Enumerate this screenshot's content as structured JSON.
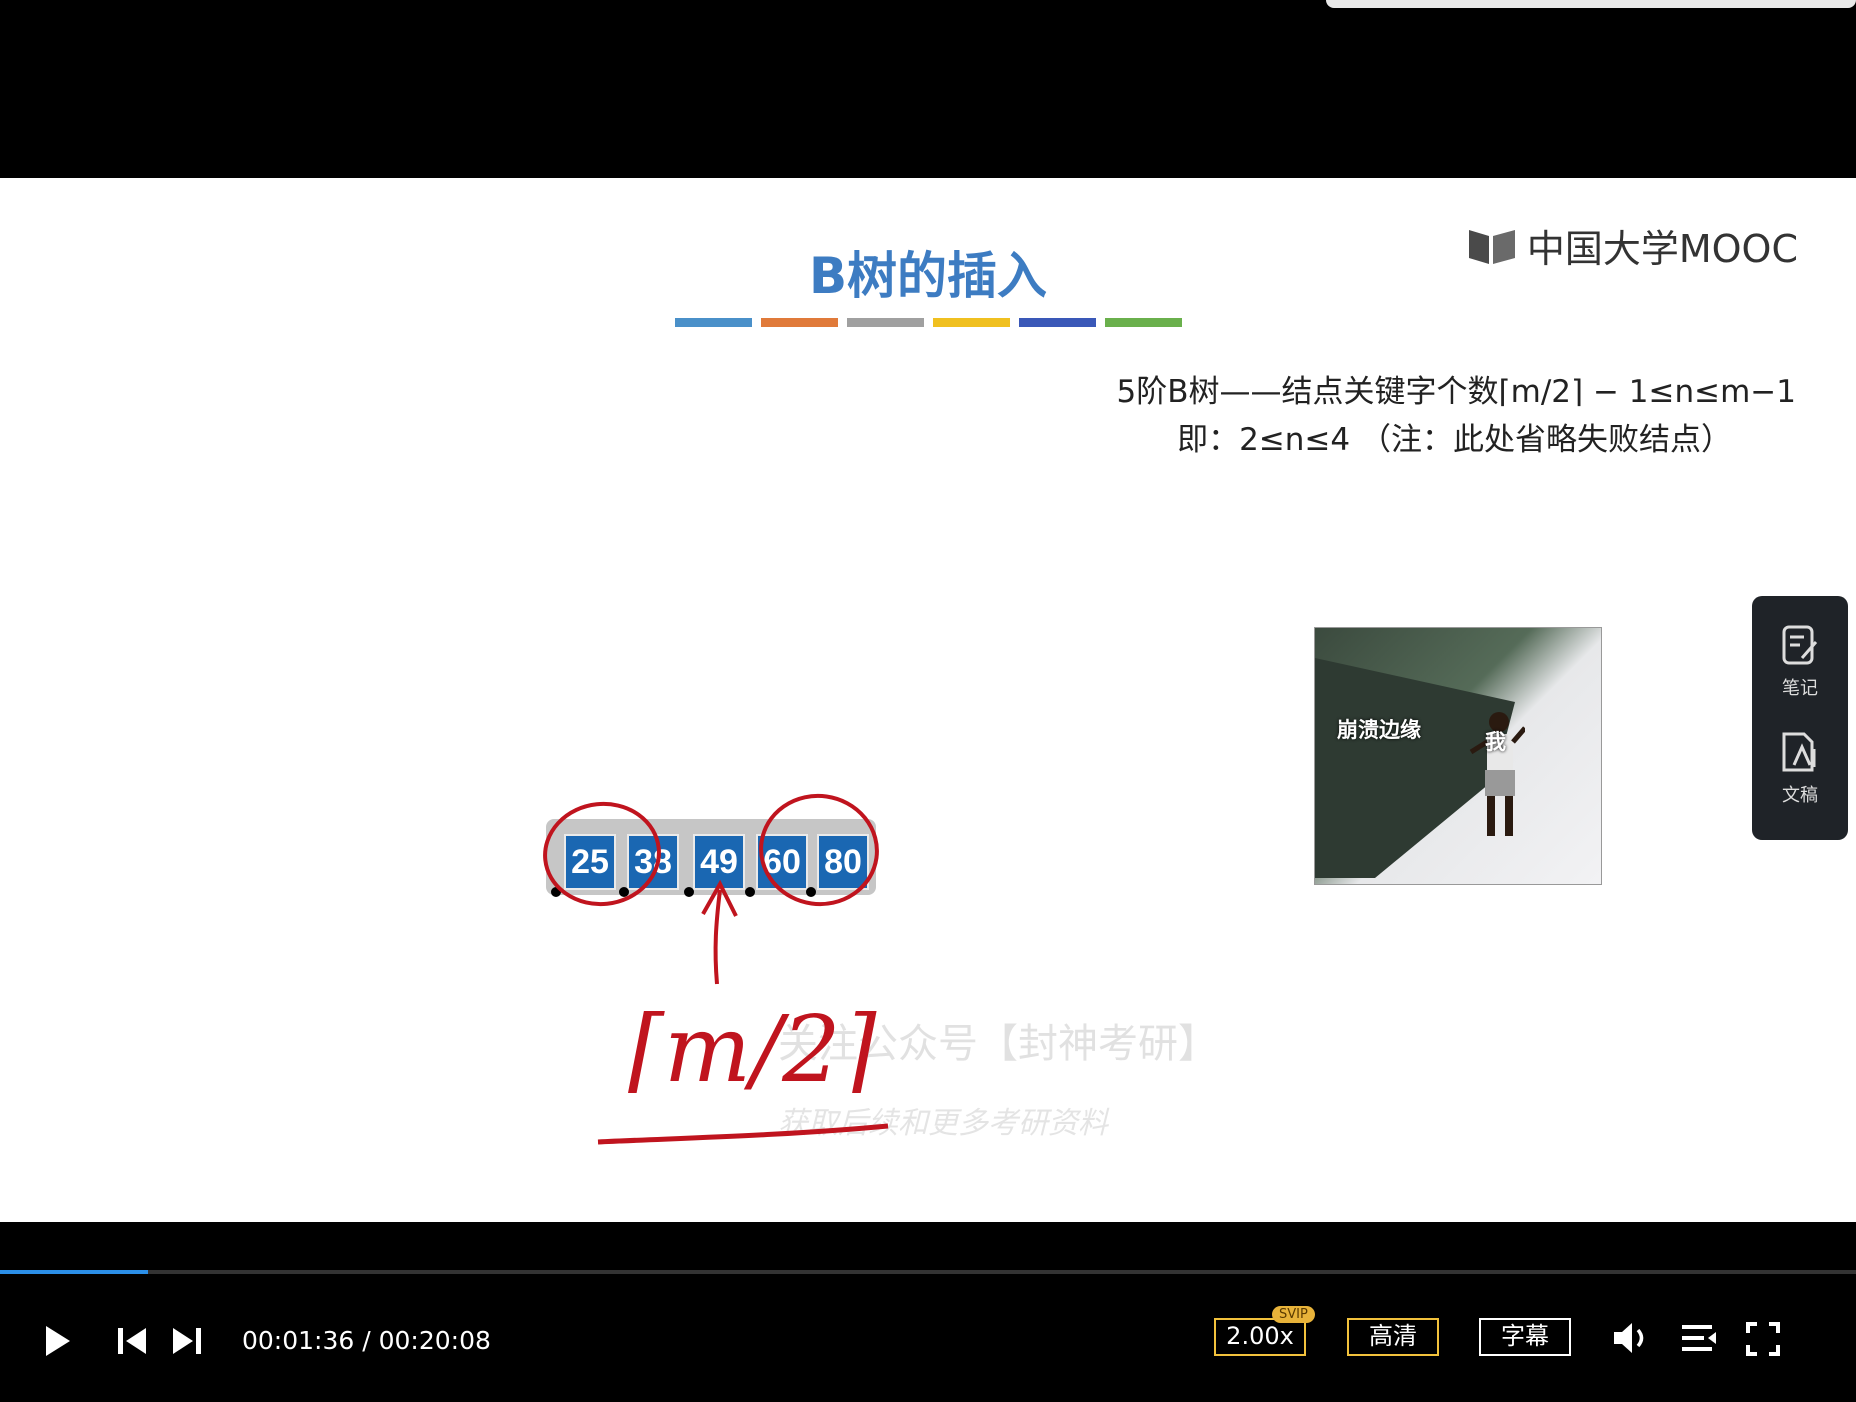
{
  "slide": {
    "title": "B树的插入",
    "color_bar": [
      "#4a90c9",
      "#e07a3a",
      "#a0a0a0",
      "#f0c020",
      "#3a58b8",
      "#6ab04c"
    ],
    "logo_text": "中国大学MOOC",
    "desc_line1": "5阶B树——结点关键字个数⌈m/2⌉ − 1≤n≤m−1",
    "desc_line2": "即：2≤n≤4 （注：此处省略失败结点）",
    "keys": [
      "25",
      "38",
      "49",
      "60",
      "80"
    ],
    "meme_label_left": "崩溃边缘",
    "meme_label_right": "我",
    "watermark_line1": "关注公众号【封神考研】",
    "watermark_line2": "获取后续和更多考研资料",
    "handwritten": "⌈m/2⌉"
  },
  "side_panel": {
    "notes_label": "笔记",
    "transcript_label": "文稿"
  },
  "player": {
    "current_time": "00:01:36",
    "separator": "/",
    "duration": "00:20:08",
    "progress_fraction": 0.0795,
    "speed_label": "2.00x",
    "svip_badge": "SVIP",
    "quality_label": "高清",
    "subtitle_label": "字幕",
    "icons": [
      "play-icon",
      "previous-icon",
      "next-icon",
      "volume-icon",
      "playlist-icon",
      "fullscreen-icon"
    ]
  }
}
